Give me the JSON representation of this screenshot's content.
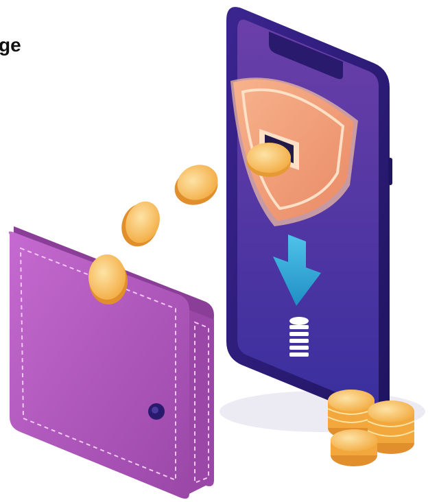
{
  "caption": {
    "text": "ge"
  },
  "illustration": {
    "subject": "phone-wallet-coin-transfer",
    "colors": {
      "phone_frame": "#2a1a6e",
      "phone_screen_top": "#6b3fa8",
      "phone_screen_bottom": "#3a2f9e",
      "wallet": "#b05ab8",
      "wallet_dark": "#8a3e98",
      "coin": "#f6b54a",
      "coin_light": "#fde3a6",
      "shield": "#f2a179",
      "arrow": "#2fa9d8"
    },
    "icons": [
      "shield-icon",
      "arrow-down-icon",
      "coin-stack-icon",
      "wallet-icon",
      "smartphone-icon"
    ]
  }
}
